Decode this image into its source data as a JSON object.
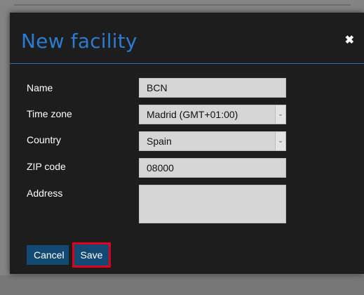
{
  "modal": {
    "title": "New facility",
    "close_glyph": "✖",
    "close_icon": "close-icon"
  },
  "form": {
    "name": {
      "label": "Name",
      "value": "BCN"
    },
    "timezone": {
      "label": "Time zone",
      "value": "Madrid (GMT+01:00)",
      "arrow_glyph": "⌄"
    },
    "country": {
      "label": "Country",
      "value": "Spain",
      "arrow_glyph": "⌄"
    },
    "zip": {
      "label": "ZIP code",
      "value": "08000"
    },
    "address": {
      "label": "Address",
      "value": ""
    }
  },
  "buttons": {
    "cancel_label": "Cancel",
    "save_label": "Save"
  },
  "colors": {
    "title_blue": "#2b7bd0",
    "button_blue": "#134a73",
    "highlight_red": "#e0001b",
    "modal_bg": "#1d1d1d",
    "field_bg": "#d6d6d6"
  }
}
